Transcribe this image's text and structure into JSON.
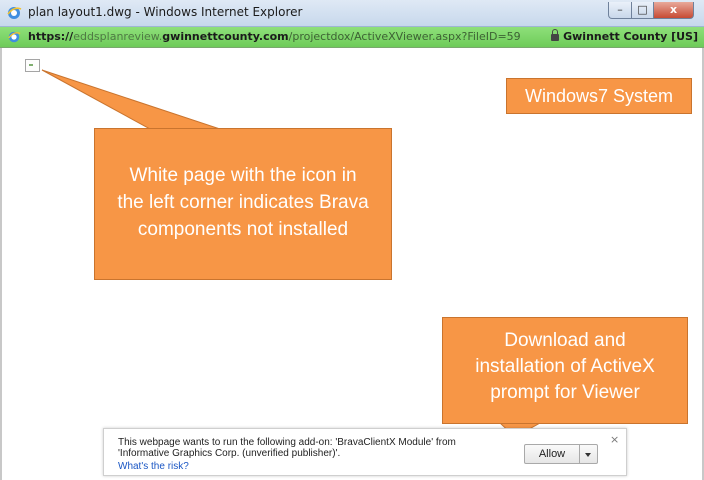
{
  "window": {
    "title": "plan layout1.dwg - Windows Internet Explorer",
    "controls": {
      "minimize": "–",
      "maximize": "□",
      "close": "x"
    }
  },
  "address": {
    "protocol": "https://",
    "subdomain": "eddsplanreview.",
    "domain": "gwinnettcounty.com",
    "path": "/projectdox/ActiveXViewer.aspx?FileID=59",
    "security_label": "Gwinnett County [US]"
  },
  "icons": {
    "browser": "ie-icon",
    "address": "ie-icon",
    "lock": "lock-icon",
    "placeholder": "broken-plugin-icon"
  },
  "callouts": {
    "windows_label": "Windows7 System",
    "main_line1": "White page with the icon in",
    "main_line2": "the left corner indicates Brava",
    "main_line3": "components not installed",
    "download_line1": "Download and",
    "download_line2": "installation of ActiveX",
    "download_line3": "prompt for Viewer"
  },
  "infobar": {
    "line1": "This webpage wants to run the following add-on: 'BravaClientX Module' from",
    "line2": "'Informative Graphics Corp. (unverified publisher)'.",
    "risk_link": "What's the risk?",
    "allow_label": "Allow",
    "close_label": "×"
  },
  "colors": {
    "callout_fill": "#f79646",
    "address_bar": "#6ecb59",
    "link": "#1a56c4"
  }
}
